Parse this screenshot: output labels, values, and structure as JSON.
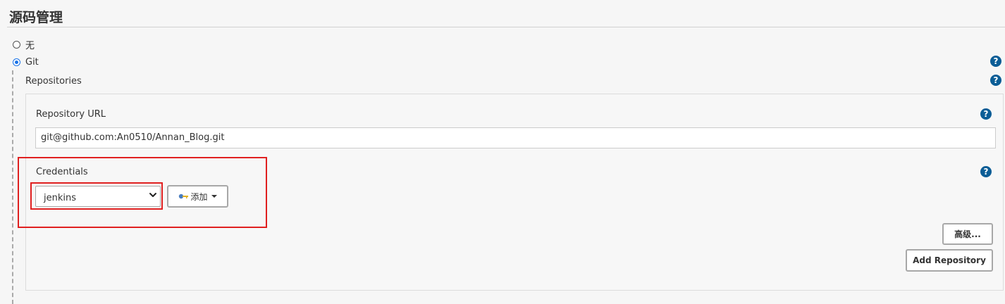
{
  "section": {
    "title": "源码管理"
  },
  "scm_options": [
    {
      "label": "无",
      "selected": false
    },
    {
      "label": "Git",
      "selected": true
    }
  ],
  "git": {
    "repositories_label": "Repositories",
    "repository_url_label": "Repository URL",
    "repository_url_value": "git@github.com:An0510/Annan_Blog.git",
    "credentials_label": "Credentials",
    "credentials_selected": "jenkins",
    "add_button_label": "添加",
    "advanced_button_label": "高级...",
    "add_repository_label": "Add Repository"
  },
  "help_icon_glyph": "?",
  "colors": {
    "help_icon": "#0b5d96",
    "radio_selected": "#1a73e8",
    "highlight": "#e02020"
  }
}
